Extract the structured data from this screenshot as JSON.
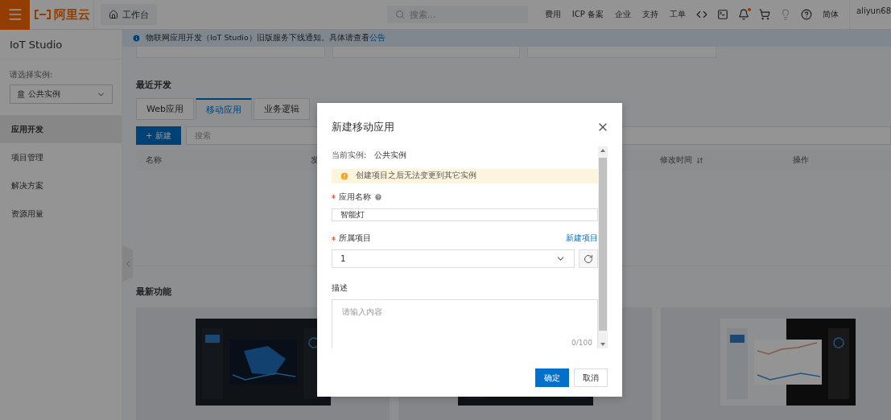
{
  "topbar": {
    "logo": "阿里云",
    "workbench": "工作台",
    "search_placeholder": "搜索...",
    "nav": [
      "费用",
      "ICP 备案",
      "企业",
      "支持",
      "工单"
    ],
    "language": "简体",
    "user": "aliyun68"
  },
  "sidebar": {
    "title": "IoT Studio",
    "instance_label": "请选择实例:",
    "instance": "公共实例",
    "items": [
      {
        "label": "应用开发",
        "selected": true
      },
      {
        "label": "项目管理",
        "selected": false
      },
      {
        "label": "解决方案",
        "selected": false
      },
      {
        "label": "资源用量",
        "selected": false
      }
    ]
  },
  "notice": {
    "text": "物联网应用开发（IoT Studio）旧版服务下线通知。具体请查看",
    "link": "公告"
  },
  "recent": {
    "title": "最近开发",
    "tabs": [
      {
        "label": "Web应用",
        "selected": false
      },
      {
        "label": "移动应用",
        "selected": true
      },
      {
        "label": "业务逻辑",
        "selected": false
      }
    ],
    "new_button": "+ 新建",
    "search_placeholder": "搜索",
    "columns": [
      "名称",
      "发",
      "修改时间",
      "操作"
    ]
  },
  "features": {
    "title": "最新功能"
  },
  "dialog": {
    "title": "新建移动应用",
    "instance_label": "当前实例:",
    "instance": "公共实例",
    "warning": "创建项目之后无法变更到其它实例",
    "name_label": "应用名称",
    "name_required": true,
    "project_required": true,
    "name_value": "智能灯",
    "project_label": "所属项目",
    "project_link": "新建项目",
    "project_value": "1",
    "description_label": "描述",
    "description_placeholder": "请输入内容",
    "counter": "0/100",
    "confirm": "确定",
    "cancel": "取消"
  }
}
